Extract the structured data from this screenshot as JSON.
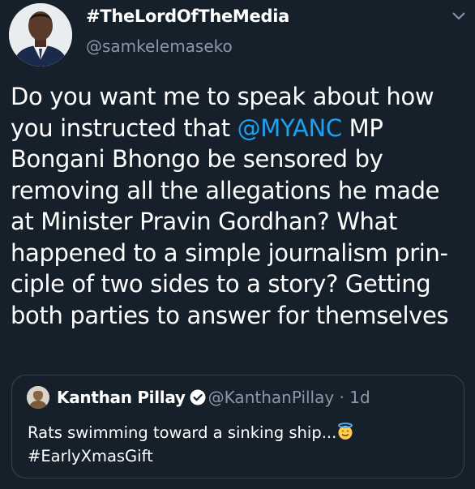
{
  "tweet": {
    "display_name": "#TheLordOfTheMedia",
    "handle": "@samkelemaseko",
    "avatar_icon": "profile-photo-icon",
    "menu_icon": "chevron-down-icon",
    "lines": [
      [
        "Do you want me to speak about how"
      ],
      [
        "you instructed that ",
        "@MYANC",
        " MP"
      ],
      [
        "Bongani Bhongo be sensored by"
      ],
      [
        "removing all the allegations he made"
      ],
      [
        "at Minister Pravin Gordhan? What"
      ],
      [
        "happened to a simple journalism prin-"
      ],
      [
        "ciple of two sides to a story? Getting"
      ],
      [
        "both parties to answer for themselves"
      ]
    ]
  },
  "quoted_tweet": {
    "name": "Kanthan Pillay",
    "verified_icon": "verified-badge-icon",
    "handle": "@KanthanPillay",
    "separator": " · ",
    "time": "1d",
    "text_line1": "Rats swimming toward a sinking ship...",
    "emoji_icon": "smiling-face-with-halo-emoji",
    "text_line2": "#EarlyXmasGift"
  },
  "colors": {
    "background": "#15202b",
    "text": "#ffffff",
    "secondary": "#8899a6",
    "link": "#1da1f2",
    "border": "#38444d"
  }
}
